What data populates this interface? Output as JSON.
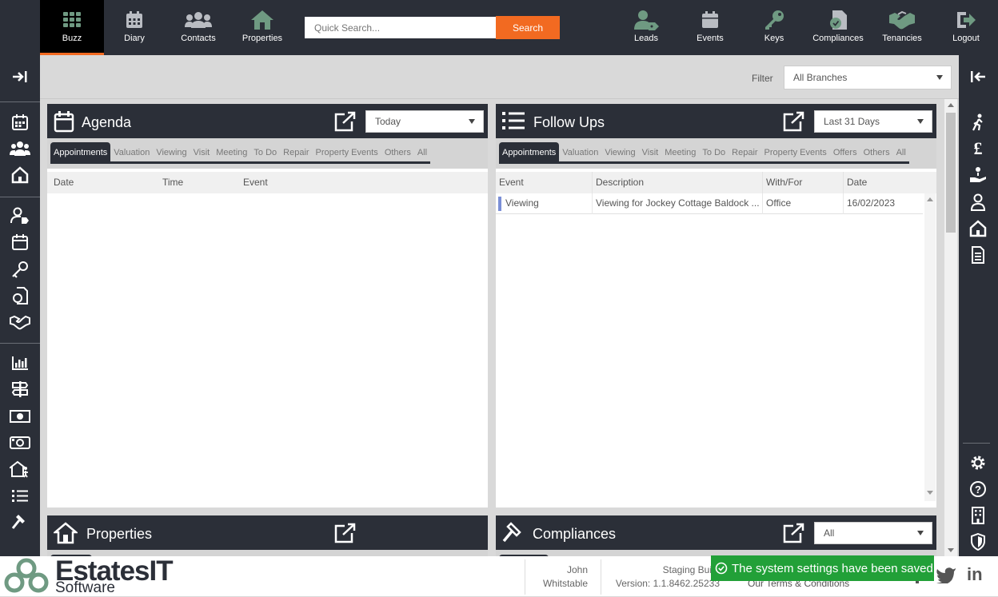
{
  "topnav": {
    "items": [
      {
        "label": "Buzz",
        "icon": "grid-icon"
      },
      {
        "label": "Diary",
        "icon": "calendar-icon"
      },
      {
        "label": "Contacts",
        "icon": "users-icon"
      },
      {
        "label": "Properties",
        "icon": "house-icon"
      },
      {
        "label": "Leads",
        "icon": "user-tag-icon"
      },
      {
        "label": "Events",
        "icon": "calendar-icon"
      },
      {
        "label": "Keys",
        "icon": "key-icon"
      },
      {
        "label": "Compliances",
        "icon": "document-icon"
      },
      {
        "label": "Tenancies",
        "icon": "handshake-icon"
      },
      {
        "label": "Logout",
        "icon": "logout-icon"
      }
    ],
    "active": "Buzz",
    "search_placeholder": "Quick Search...",
    "search_button": "Search"
  },
  "filter": {
    "label": "Filter",
    "value": "All Branches"
  },
  "agenda": {
    "title": "Agenda",
    "range": "Today",
    "tabs": [
      "Appointments",
      "Valuation",
      "Viewing",
      "Visit",
      "Meeting",
      "To Do",
      "Repair",
      "Property Events",
      "Others",
      "All"
    ],
    "columns": [
      "Date",
      "Time",
      "Event"
    ],
    "rows": []
  },
  "followups": {
    "title": "Follow Ups",
    "range": "Last 31 Days",
    "tabs": [
      "Appointments",
      "Valuation",
      "Viewing",
      "Visit",
      "Meeting",
      "To Do",
      "Repair",
      "Property Events",
      "Offers",
      "Others",
      "All"
    ],
    "columns": [
      "Event",
      "Description",
      "With/For",
      "Date"
    ],
    "rows": [
      {
        "event": "Viewing",
        "description": "Viewing for Jockey Cottage Baldock ...",
        "with_for": "Office",
        "date": "16/02/2023"
      }
    ]
  },
  "properties_panel": {
    "title": "Properties"
  },
  "compliances_panel": {
    "title": "Compliances",
    "range": "All"
  },
  "footer": {
    "logo_main": "EstatesIT",
    "logo_sub": "Software",
    "user_first": "John",
    "user_branch": "Whitstable",
    "build_label": "Staging Bui",
    "version": "Version: 1.1.8462.25233",
    "terms": "Our Terms & Conditions"
  },
  "toast": {
    "message": "The system settings have been saved"
  },
  "colors": {
    "dark": "#2b2f38",
    "accent": "#f26a21",
    "icon_green": "#6f9a82",
    "success": "#22a038"
  }
}
